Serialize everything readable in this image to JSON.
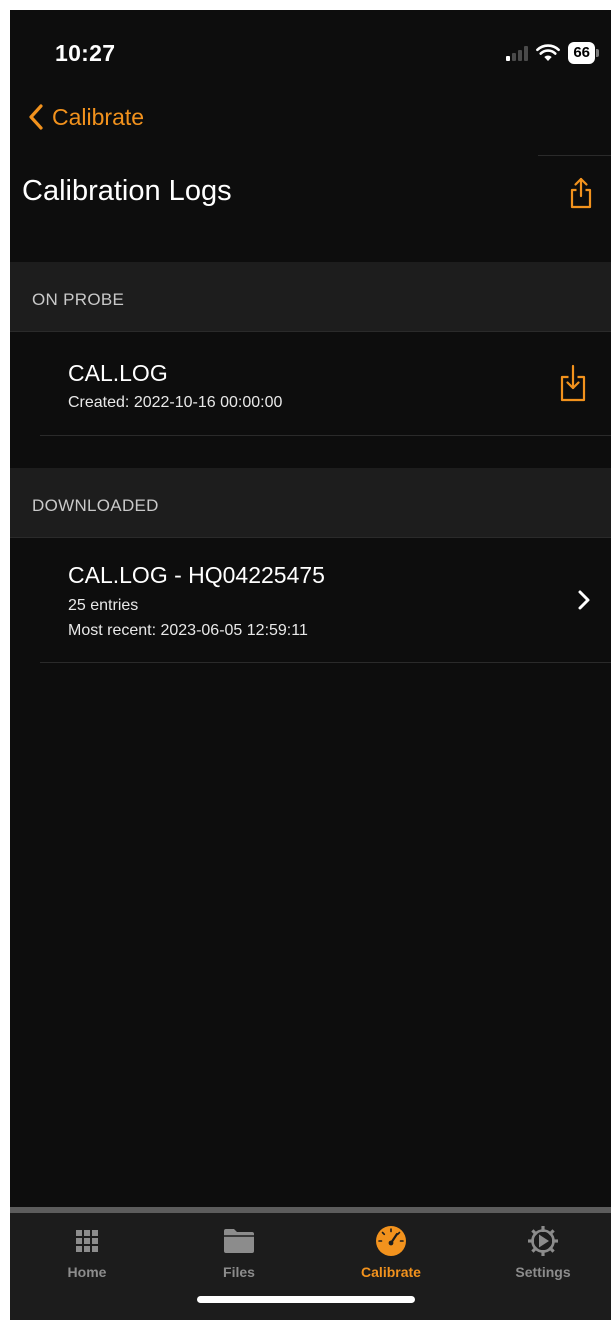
{
  "status_bar": {
    "time": "10:27",
    "battery": "66"
  },
  "nav": {
    "back_label": "Calibrate",
    "title": "Calibration Logs"
  },
  "sections": {
    "on_probe": {
      "header": "ON PROBE",
      "item": {
        "title": "CAL.LOG",
        "created": "Created: 2022-10-16 00:00:00"
      }
    },
    "downloaded": {
      "header": "DOWNLOADED",
      "item": {
        "title": "CAL.LOG - HQ04225475",
        "entries": "25 entries",
        "most_recent": "Most recent: 2023-06-05 12:59:11"
      }
    }
  },
  "tabs": [
    {
      "label": "Home",
      "icon": "grid-icon"
    },
    {
      "label": "Files",
      "icon": "folder-icon"
    },
    {
      "label": "Calibrate",
      "icon": "gauge-icon",
      "active": true
    },
    {
      "label": "Settings",
      "icon": "gear-icon"
    }
  ],
  "colors": {
    "accent": "#f2921d",
    "background": "#0d0d0d",
    "section_header": "#1d1d1d",
    "tab_bar": "#1c1c1c"
  }
}
